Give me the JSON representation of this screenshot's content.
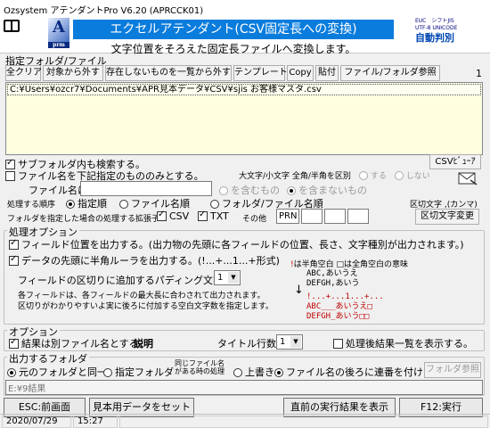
{
  "window": {
    "title": "Ozsystem アテンダントPro V6.20 (APRCCK01)"
  },
  "header": {
    "banner": "エクセルアテンダント(CSV固定長への変換)",
    "subtitle": "文字位置をそろえた固定長ファイルへ変換します。",
    "logo_a": "A",
    "logo_a_sub": "prm",
    "logo_enc_line1": "EUC　シフトJIS",
    "logo_enc_line2": "UTF-8 UNICODE",
    "logo_enc_brand": "自動判別"
  },
  "folder_section": {
    "label": "指定フォルダ/ファイル",
    "buttons": [
      "全クリア",
      "対象から外す",
      "存在しないものを一覧から外す",
      "テンプレート",
      "Copy",
      "貼付",
      "ファイル/フォルダ参照"
    ],
    "count": "1",
    "files": [
      "C:¥Users¥ozcr7¥Documents¥APR見本データ¥CSV¥sjis お客様マスタ.csv"
    ]
  },
  "subfolder_option": {
    "label": "サブフォルダ内も検索する。",
    "checked": true
  },
  "name_filter_option": {
    "label": "ファイル名を下記指定のもののみとする。",
    "checked": false
  },
  "case_option": {
    "label": "大文字/小文字 全角/半角を区別",
    "yes": "する",
    "no": "しない"
  },
  "csv_viewer_button": "CSVﾋﾞｭｰｱ",
  "file_name_filter": {
    "label": "ファイル名に",
    "value": "",
    "include": "を含むもの",
    "exclude": "を含まないもの"
  },
  "process_order": {
    "label": "処理する順序",
    "options": [
      "指定順",
      "ファイル名順",
      "フォルダ/ファイル名順"
    ],
    "selected": 0
  },
  "extensions": {
    "label": "フォルダを指定した場合の処理する拡張子",
    "csv": "CSV",
    "txt": "TXT",
    "other_label": "その他",
    "other_values": [
      "PRN",
      "",
      "",
      ""
    ]
  },
  "delimiter": {
    "label": "区切文字 ,(カンマ)",
    "button": "区切文字変更"
  },
  "processing_options": {
    "label": "処理オプション",
    "output_position": {
      "label": "フィールド位置を出力する。(出力物の先頭に各フィールドの位置、長さ、文字種別が出力されます。)",
      "checked": true
    },
    "ruler": {
      "label": "データの先頭に半角ルーラを出力する。(!...+...1...+形式)",
      "checked": true
    },
    "padding_label": "フィールドの区切りに追加するパディング文字数",
    "padding_value": "1",
    "note_line1": "各フィールドは、各フィールドの最大長に合わされて出力されます。",
    "note_line2": "区切りがわかりやすいよ実に後ろに付加する空白文字数を指定します。",
    "legend_text": "は半角空白 □は全角空白の意味",
    "legend_mark": "!",
    "sample_before_1": "ABC,あいうえ",
    "sample_before_2": "DEFGH,あいう",
    "arrow": "↓",
    "sample_ruler": "!...+...1...+...",
    "sample_after_1": "ABC___あいうえ□",
    "sample_after_2": "DEFGH_あいう□□"
  },
  "options": {
    "label": "オプション",
    "separate_file": {
      "label": "結果は別ファイル名とする。",
      "checked": true
    },
    "description": "説明",
    "title_rows_label": "タイトル行数",
    "title_rows_value": "1",
    "show_results": {
      "label": "処理後結果一覧を表示する。",
      "checked": false
    }
  },
  "output_folder": {
    "label": "出力するフォルダ",
    "same_as_source": "元のフォルダと同一",
    "specified": "指定フォルダ",
    "same_name_line1": "同じファイル名",
    "same_name_line2": "がある時の処理",
    "overwrite": "上書き",
    "append_seq": "ファイル名の後ろに連番を付ける",
    "browse_button": "フォルダ参照",
    "path_value": "E:¥9結果"
  },
  "footer": {
    "esc_button": "ESC:前画面",
    "sample_button": "見本用データをセット",
    "last_result_button": "直前の実行結果を表示",
    "run_button": "F12:実行"
  },
  "status": {
    "date": "2020/07/29",
    "time": "15:27"
  },
  "icons": {
    "book": "book-icon",
    "viewer": "envelope-icon"
  },
  "colors": {
    "banner": "#0a7cdc",
    "list_bg": "#ffffe0",
    "accent_red": "#c00000"
  }
}
